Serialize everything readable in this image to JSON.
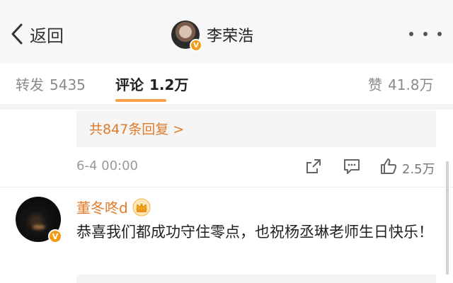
{
  "header": {
    "back_label": "返回",
    "owner_name": "李荣浩",
    "badge": "V"
  },
  "tabs": {
    "repost_label": "转发",
    "repost_count": "5435",
    "comment_label": "评论",
    "comment_count": "1.2万",
    "like_label": "赞",
    "like_count": "41.8万"
  },
  "thread": {
    "replies_text": "共847条回复 >",
    "date": "6-4 00:00",
    "likes": "2.5万"
  },
  "comment": {
    "author": "董冬咚d",
    "badge": "V",
    "text": "恭喜我们都成功守住零点，也祝杨丞琳老师生日快乐！"
  },
  "colors": {
    "accent": "#e07b2a",
    "tab_indicator": "#f6a04a",
    "badge": "#f29b16"
  }
}
